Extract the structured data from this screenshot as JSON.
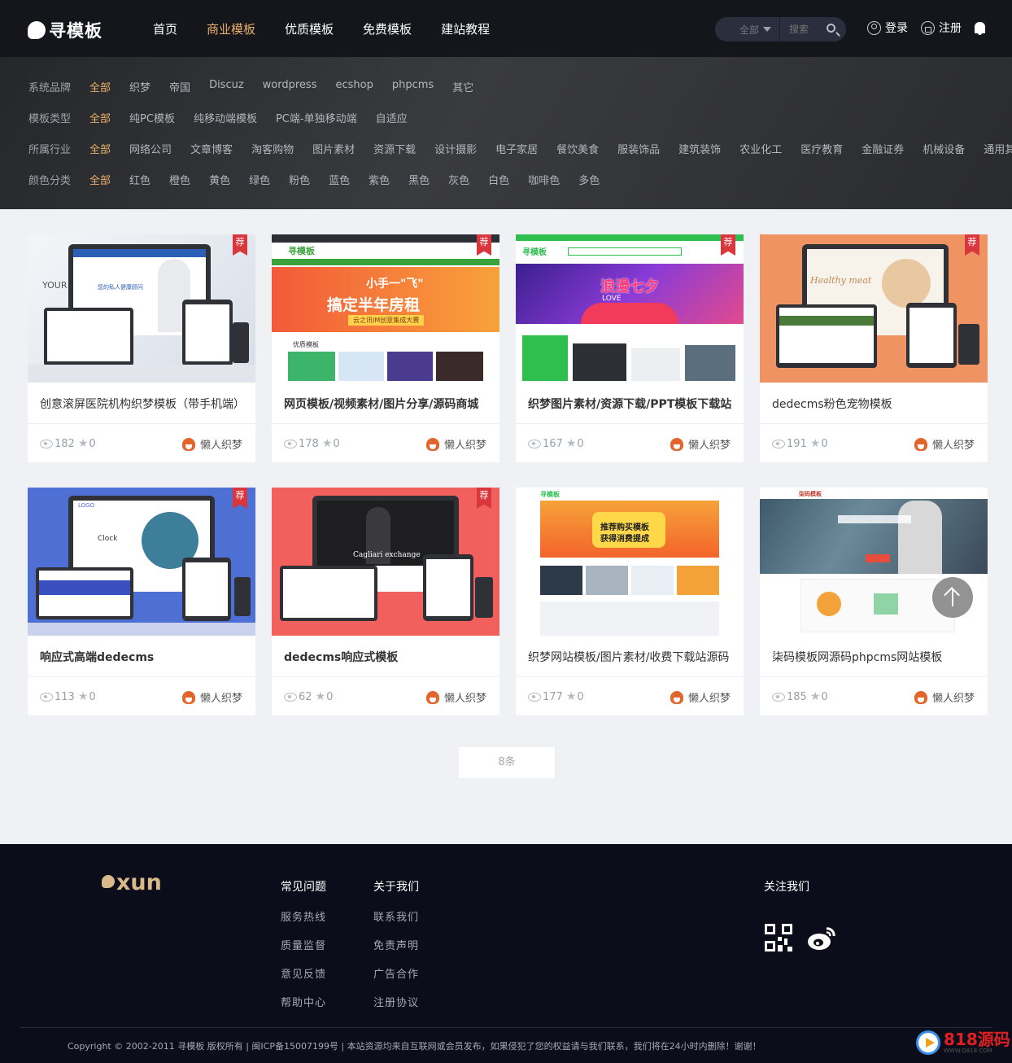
{
  "header": {
    "logo_text": "寻模板",
    "nav": [
      "首页",
      "商业模板",
      "优质模板",
      "免费模板",
      "建站教程"
    ],
    "nav_active_index": 1,
    "search_category": "全部",
    "search_placeholder": "搜索",
    "login": "登录",
    "register": "注册"
  },
  "filters": [
    {
      "label": "系统品牌",
      "options": [
        "全部",
        "织梦",
        "帝国",
        "Discuz",
        "wordpress",
        "ecshop",
        "phpcms",
        "其它"
      ]
    },
    {
      "label": "模板类型",
      "options": [
        "全部",
        "纯PC模板",
        "纯移动端模板",
        "PC端-单独移动端",
        "自适应"
      ]
    },
    {
      "label": "所属行业",
      "options": [
        "全部",
        "网络公司",
        "文章博客",
        "淘客购物",
        "图片素材",
        "资源下载",
        "设计摄影",
        "电子家居",
        "餐饮美食",
        "服装饰品",
        "建筑装饰",
        "农业化工",
        "医疗教育",
        "金融证券",
        "机械设备",
        "通用其他"
      ]
    },
    {
      "label": "颜色分类",
      "options": [
        "全部",
        "红色",
        "橙色",
        "黄色",
        "绿色",
        "粉色",
        "蓝色",
        "紫色",
        "黑色",
        "灰色",
        "白色",
        "咖啡色",
        "多色"
      ]
    }
  ],
  "cards": [
    {
      "title": "创意滚屏医院机构织梦模板（带手机端）",
      "views": "182",
      "stars": "0",
      "author": "懒人织梦",
      "recommended": true,
      "bold": false,
      "theme": "#e8ecf2",
      "overlay_text": [
        "YOUR",
        "您的私人健康顾问"
      ]
    },
    {
      "title": "网页模板/视频素材/图片分享/源码商城",
      "views": "178",
      "stars": "0",
      "author": "懒人织梦",
      "recommended": true,
      "bold": true,
      "theme": "#f35a3a",
      "overlay_text": [
        "寻模板",
        "小手一\"飞\"",
        "搞定半年房租",
        "云之讯IM创意集成大赛",
        "优质模板"
      ]
    },
    {
      "title": "织梦图片素材/资源下载/PPT模板下载站",
      "views": "167",
      "stars": "0",
      "author": "懒人织梦",
      "recommended": true,
      "bold": true,
      "theme": "#7a3bd6",
      "overlay_text": [
        "寻模板",
        "浪漫七夕",
        "LOVE"
      ]
    },
    {
      "title": "dedecms粉色宠物模板",
      "views": "191",
      "stars": "0",
      "author": "懒人织梦",
      "recommended": true,
      "bold": false,
      "theme": "#ef9363",
      "overlay_text": [
        "Healthy meat"
      ]
    },
    {
      "title": "响应式高端dedecms",
      "views": "113",
      "stars": "0",
      "author": "懒人织梦",
      "recommended": true,
      "bold": true,
      "theme": "#4e6fd3",
      "overlay_text": [
        "LOGO",
        "Clock"
      ]
    },
    {
      "title": "dedecms响应式模板",
      "views": "62",
      "stars": "0",
      "author": "懒人织梦",
      "recommended": true,
      "bold": true,
      "theme": "#f2605e",
      "overlay_text": [
        "Cagliari exchange"
      ]
    },
    {
      "title": "织梦网站模板/图片素材/收费下载站源码",
      "views": "177",
      "stars": "0",
      "author": "懒人织梦",
      "recommended": false,
      "bold": false,
      "theme": "#f3642b",
      "overlay_text": [
        "寻模板",
        "推荐购买模板",
        "获得消费提成"
      ]
    },
    {
      "title": "柒码模板网源码phpcms网站模板",
      "views": "185",
      "stars": "0",
      "author": "懒人织梦",
      "recommended": false,
      "bold": false,
      "theme": "#4e6c80",
      "overlay_text": [
        "柒码模板"
      ]
    }
  ],
  "recommend_badge": "荐",
  "pager": "8条",
  "footer": {
    "logo": "xun",
    "col1": {
      "title": "常见问题",
      "items": [
        "服务热线",
        "质量监督",
        "意见反馈",
        "帮助中心"
      ]
    },
    "col2": {
      "title": "关于我们",
      "items": [
        "联系我们",
        "免责声明",
        "广告合作",
        "注册协议"
      ]
    },
    "follow": "关注我们",
    "copyright": "Copyright © 2002-2011 寻模板 版权所有 | 闽ICP备15007199号  |  本站资源均来自互联网或会员发布，如果侵犯了您的权益请与我们联系，我们将在24小时内删除！谢谢！"
  },
  "watermark": {
    "big": "818源码",
    "small": "WWW.Q818.COM"
  }
}
